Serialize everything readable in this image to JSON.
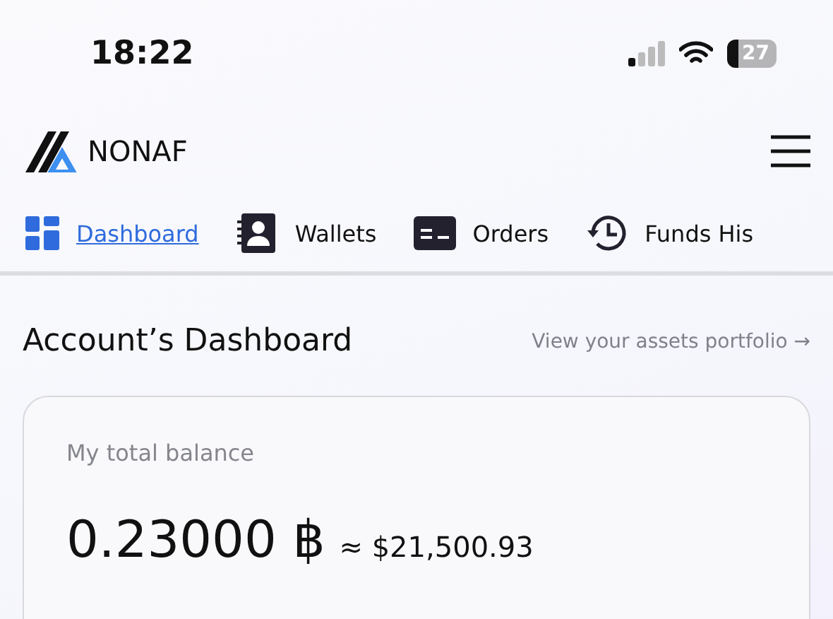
{
  "status_bar": {
    "time": "18:22",
    "battery": "27"
  },
  "header": {
    "logo": "NONAF"
  },
  "tabs": [
    {
      "label": "Dashboard",
      "selected": true
    },
    {
      "label": "Wallets",
      "selected": false
    },
    {
      "label": "Orders",
      "selected": false
    },
    {
      "label": "Funds His",
      "selected": false
    }
  ],
  "page": {
    "title": "Account’s Dashboard",
    "link": "View your assets portfolio →"
  },
  "balance_card": {
    "label": "My total balance",
    "amount": "0.23000 ฿",
    "fiat": "≈ $21,500.93"
  }
}
